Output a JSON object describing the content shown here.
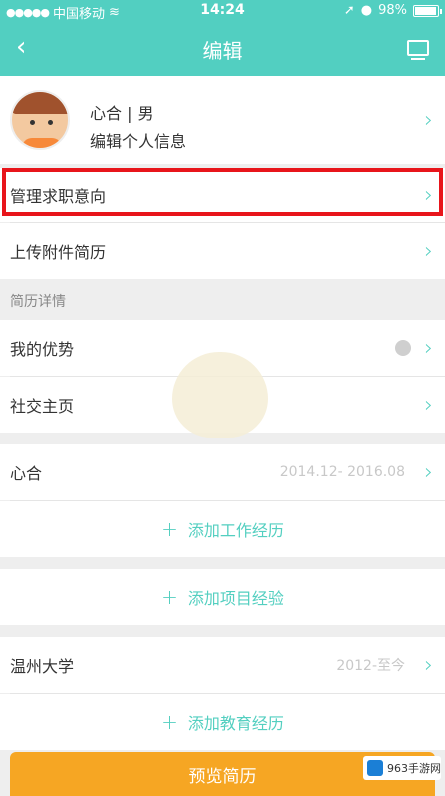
{
  "status_bar": {
    "signal": "●●●●●",
    "carrier": "中国移动",
    "wifi_icon": "wifi-icon",
    "time": "14:24",
    "battery_pct": "98%",
    "battery_level": 0.98
  },
  "nav": {
    "back": "‹",
    "title": "编辑"
  },
  "profile": {
    "name_gender": "心合 | 男",
    "edit_label": "编辑个人信息"
  },
  "menu": {
    "manage_intention": "管理求职意向",
    "upload_attachment": "上传附件简历"
  },
  "resume_details": {
    "section_title": "简历详情",
    "advantage": "我的优势",
    "social": "社交主页"
  },
  "work": {
    "company": "心合",
    "period": "2014.12- 2016.08",
    "add_label": "添加工作经历"
  },
  "project": {
    "add_label": "添加项目经验"
  },
  "education": {
    "school": "温州大学",
    "period": "2012-至今",
    "add_label": "添加教育经历"
  },
  "footer": {
    "preview_label": "预览简历",
    "watermark": "963手游网"
  },
  "colors": {
    "accent": "#52cfc1",
    "highlight_border": "#e8151b",
    "button": "#f6a623"
  }
}
